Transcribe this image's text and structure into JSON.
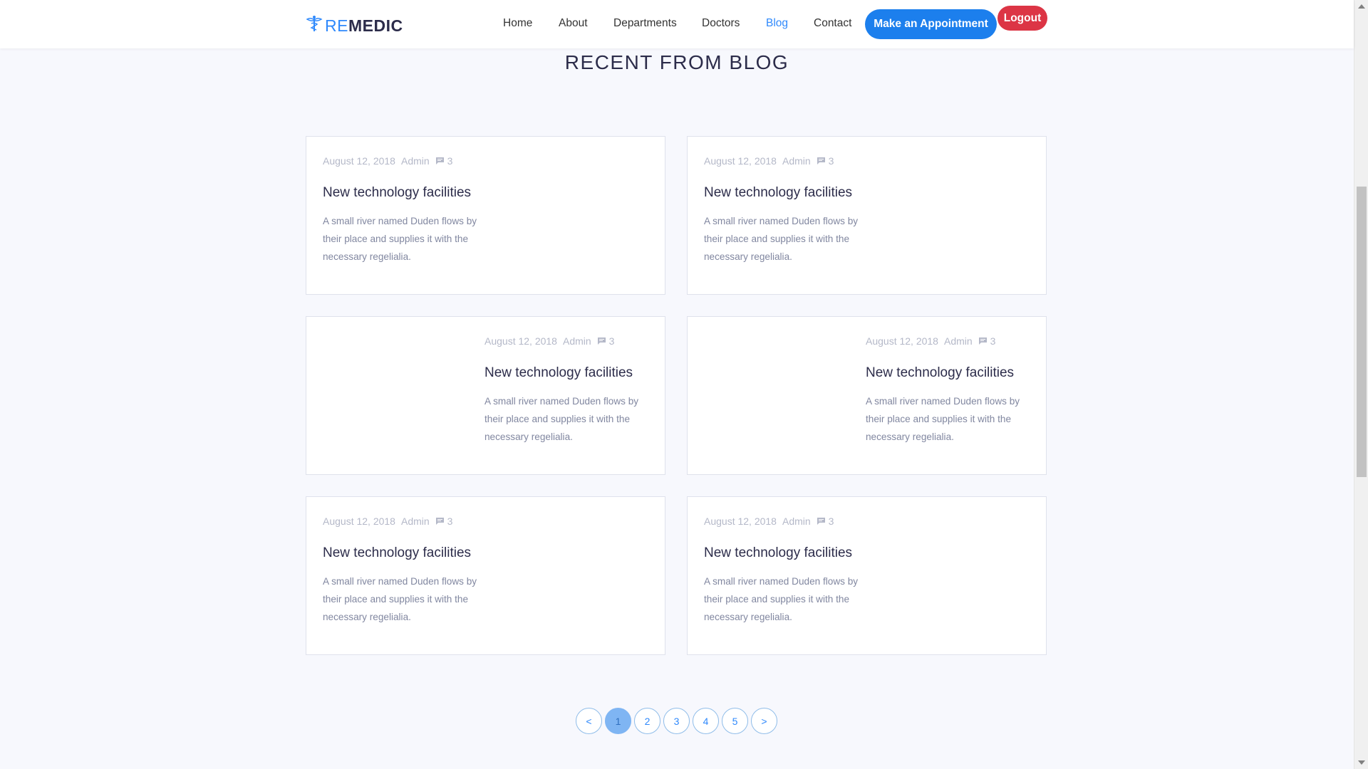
{
  "brand": {
    "part1": "RE",
    "part2": "MEDIC",
    "icon": "caduceus-icon"
  },
  "nav": {
    "items": [
      {
        "label": "Home"
      },
      {
        "label": "About"
      },
      {
        "label": "Departments"
      },
      {
        "label": "Doctors"
      },
      {
        "label": "Blog",
        "active": true
      },
      {
        "label": "Contact"
      }
    ],
    "appointment_label": "Make an Appointment",
    "logout_label": "Logout"
  },
  "section": {
    "title": "RECENT FROM BLOG"
  },
  "posts": [
    {
      "date": "August 12, 2018",
      "author": "Admin",
      "comments": "3",
      "title": "New technology facilities",
      "excerpt": "A small river named Duden flows by their place and supplies it with the necessary regelialia."
    },
    {
      "date": "August 12, 2018",
      "author": "Admin",
      "comments": "3",
      "title": "New technology facilities",
      "excerpt": "A small river named Duden flows by their place and supplies it with the necessary regelialia."
    },
    {
      "date": "August 12, 2018",
      "author": "Admin",
      "comments": "3",
      "title": "New technology facilities",
      "excerpt": "A small river named Duden flows by their place and supplies it with the necessary regelialia."
    },
    {
      "date": "August 12, 2018",
      "author": "Admin",
      "comments": "3",
      "title": "New technology facilities",
      "excerpt": "A small river named Duden flows by their place and supplies it with the necessary regelialia."
    },
    {
      "date": "August 12, 2018",
      "author": "Admin",
      "comments": "3",
      "title": "New technology facilities",
      "excerpt": "A small river named Duden flows by their place and supplies it with the necessary regelialia."
    },
    {
      "date": "August 12, 2018",
      "author": "Admin",
      "comments": "3",
      "title": "New technology facilities",
      "excerpt": "A small river named Duden flows by their place and supplies it with the necessary regelialia."
    }
  ],
  "pagination": {
    "prev": "<",
    "pages": [
      "1",
      "2",
      "3",
      "4",
      "5"
    ],
    "current": "1",
    "next": ">"
  },
  "colors": {
    "accent": "#2f89fc",
    "appointment_button": "#1c7fed",
    "logout_button": "#dc3545",
    "background": "#f7f8fd"
  }
}
